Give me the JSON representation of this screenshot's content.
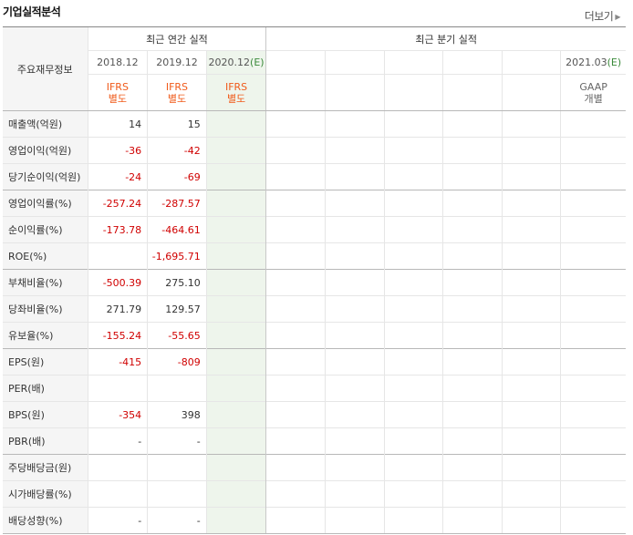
{
  "header": {
    "title": "기업실적분석",
    "more_label": "더보기"
  },
  "table": {
    "row_header_label": "주요재무정보",
    "group_annual": "최근 연간 실적",
    "group_quarter": "최근 분기 실적",
    "annual_periods": [
      {
        "date": "2018.12",
        "acc": "IFRS",
        "acc_sub": "별도"
      },
      {
        "date": "2019.12",
        "acc": "IFRS",
        "acc_sub": "별도"
      },
      {
        "date": "2020.12",
        "date_mark": "(E)",
        "acc": "IFRS",
        "acc_sub": "별도"
      }
    ],
    "quarter_last": {
      "date": "2021.03",
      "date_mark": "(E)",
      "acc": "GAAP",
      "acc_sub": "개별"
    },
    "rows": [
      {
        "label": "매출액(억원)",
        "v": [
          "14",
          "15"
        ]
      },
      {
        "label": "영업이익(억원)",
        "v": [
          "-36",
          "-42"
        ]
      },
      {
        "label": "당기순이익(억원)",
        "v": [
          "-24",
          "-69"
        ]
      },
      {
        "label": "영업이익률(%)",
        "v": [
          "-257.24",
          "-287.57"
        ]
      },
      {
        "label": "순이익률(%)",
        "v": [
          "-173.78",
          "-464.61"
        ]
      },
      {
        "label": "ROE(%)",
        "v": [
          "",
          "-1,695.71"
        ]
      },
      {
        "label": "부채비율(%)",
        "v": [
          "-500.39",
          "275.10"
        ]
      },
      {
        "label": "당좌비율(%)",
        "v": [
          "271.79",
          "129.57"
        ]
      },
      {
        "label": "유보율(%)",
        "v": [
          "-155.24",
          "-55.65"
        ]
      },
      {
        "label": "EPS(원)",
        "v": [
          "-415",
          "-809"
        ]
      },
      {
        "label": "PER(배)",
        "v": [
          "",
          ""
        ]
      },
      {
        "label": "BPS(원)",
        "v": [
          "-354",
          "398"
        ]
      },
      {
        "label": "PBR(배)",
        "v": [
          "-",
          "-"
        ]
      },
      {
        "label": "주당배당금(원)",
        "v": [
          "",
          ""
        ]
      },
      {
        "label": "시가배당률(%)",
        "v": [
          "",
          ""
        ]
      },
      {
        "label": "배당성향(%)",
        "v": [
          "-",
          "-"
        ]
      }
    ],
    "colors": {
      "negative": "#d00000",
      "ifrs": "#f05a1a",
      "estimate_bg": "#eef5ec"
    }
  }
}
